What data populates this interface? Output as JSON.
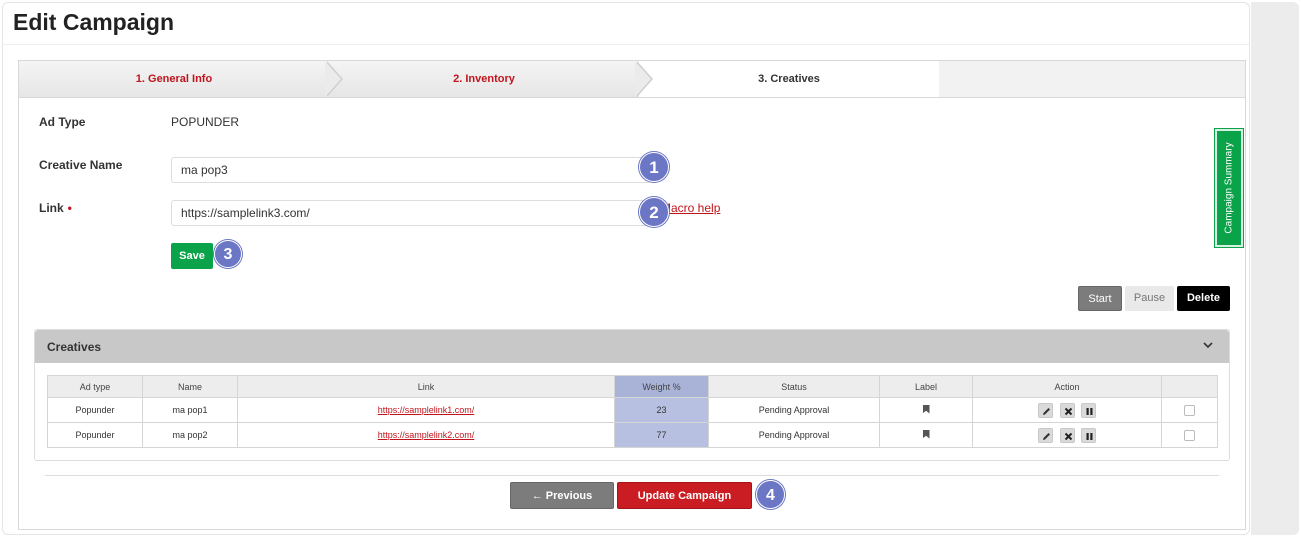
{
  "page": {
    "title": "Edit Campaign"
  },
  "steps": [
    {
      "label": "1. General Info"
    },
    {
      "label": "2. Inventory"
    },
    {
      "label": "3. Creatives"
    }
  ],
  "form": {
    "ad_type_label": "Ad Type",
    "ad_type_value": "POPUNDER",
    "creative_name_label": "Creative Name",
    "creative_name_value": "ma pop3",
    "link_label": "Link",
    "link_required_mark": "•",
    "link_value": "https://samplelink3.com/",
    "macro_help": "Macro help",
    "save_label": "Save"
  },
  "side_tab": {
    "label": "Campaign Summary"
  },
  "actions": {
    "start": "Start",
    "pause": "Pause",
    "delete": "Delete"
  },
  "creatives": {
    "title": "Creatives",
    "columns": [
      "Ad type",
      "Name",
      "Link",
      "Weight %",
      "Status",
      "Label",
      "Action",
      ""
    ],
    "rows": [
      {
        "ad_type": "Popunder",
        "name": "ma pop1",
        "link": "https://samplelink1.com/",
        "weight": "23",
        "status": "Pending Approval"
      },
      {
        "ad_type": "Popunder",
        "name": "ma pop2",
        "link": "https://samplelink2.com/",
        "weight": "77",
        "status": "Pending Approval"
      }
    ]
  },
  "footer": {
    "previous": "← Previous",
    "update": "Update Campaign"
  },
  "badges": [
    "1",
    "2",
    "3",
    "4"
  ],
  "colors": {
    "brand_red": "#c0141c",
    "save_green": "#0aa34a",
    "badge": "#6b76c4",
    "weight_col": "#b8c0e2"
  }
}
